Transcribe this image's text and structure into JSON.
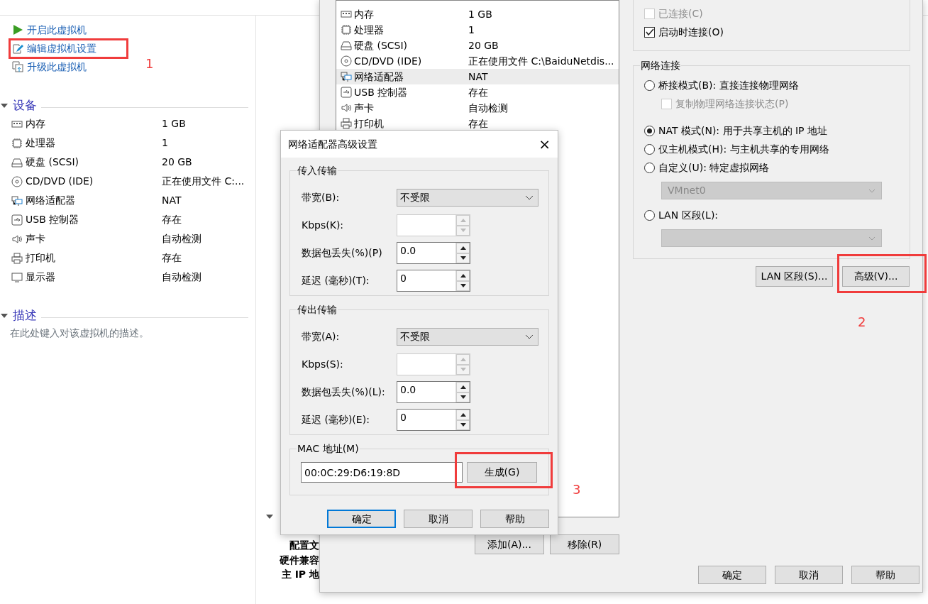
{
  "vm_panel": {
    "actions": [
      {
        "kind": "play",
        "label": "开启此虚拟机"
      },
      {
        "kind": "edit",
        "label": "编辑虚拟机设置"
      },
      {
        "kind": "upgrade",
        "label": "升级此虚拟机"
      }
    ],
    "devices_section": {
      "title": "设备",
      "expanded": true,
      "rows": [
        {
          "kind": "memory",
          "name": "内存",
          "value": "1 GB"
        },
        {
          "kind": "cpu",
          "name": "处理器",
          "value": "1"
        },
        {
          "kind": "disk",
          "name": "硬盘 (SCSI)",
          "value": "20 GB"
        },
        {
          "kind": "cd",
          "name": "CD/DVD (IDE)",
          "value": "正在使用文件 C:..."
        },
        {
          "kind": "network",
          "name": "网络适配器",
          "value": "NAT"
        },
        {
          "kind": "usb",
          "name": "USB 控制器",
          "value": "存在"
        },
        {
          "kind": "sound",
          "name": "声卡",
          "value": "自动检测"
        },
        {
          "kind": "printer",
          "name": "打印机",
          "value": "存在"
        },
        {
          "kind": "display",
          "name": "显示器",
          "value": "自动检测"
        }
      ]
    },
    "description_section": {
      "title": "描述",
      "expanded": true,
      "placeholder": "在此处键入对该虚拟机的描述。"
    },
    "details_section": {
      "expanded": true,
      "labels": [
        "配置文",
        "硬件兼容",
        "主 IP 地"
      ]
    }
  },
  "settings": {
    "devices": [
      {
        "kind": "memory",
        "name": "内存",
        "summary": "1 GB",
        "selected": false
      },
      {
        "kind": "cpu",
        "name": "处理器",
        "summary": "1",
        "selected": false
      },
      {
        "kind": "disk",
        "name": "硬盘 (SCSI)",
        "summary": "20 GB",
        "selected": false
      },
      {
        "kind": "cd",
        "name": "CD/DVD (IDE)",
        "summary": "正在使用文件 C:\\BaiduNetdis...",
        "selected": false
      },
      {
        "kind": "network",
        "name": "网络适配器",
        "summary": "NAT",
        "selected": true
      },
      {
        "kind": "usb",
        "name": "USB 控制器",
        "summary": "存在",
        "selected": false
      },
      {
        "kind": "sound",
        "name": "声卡",
        "summary": "自动检测",
        "selected": false
      },
      {
        "kind": "printer",
        "name": "打印机",
        "summary": "存在",
        "selected": false
      }
    ],
    "list_buttons": [
      "添加(A)...",
      "移除(R)"
    ],
    "device_status": [
      {
        "label": "已连接(C)",
        "checked": false,
        "disabled": true
      },
      {
        "label": "启动时连接(O)",
        "checked": true,
        "disabled": false
      }
    ],
    "network": {
      "title": "网络连接",
      "options": [
        {
          "kind": "radio",
          "label": "桥接模式(B): 直接连接物理网络",
          "selected": false
        },
        {
          "kind": "checkbox",
          "label": "复制物理网络连接状态(P)",
          "checked": false,
          "disabled": true
        },
        {
          "kind": "radio",
          "label": "NAT 模式(N): 用于共享主机的 IP 地址",
          "selected": true
        },
        {
          "kind": "radio",
          "label": "仅主机模式(H): 与主机共享的专用网络",
          "selected": false
        },
        {
          "kind": "radio",
          "label": "自定义(U): 特定虚拟网络",
          "selected": false
        },
        {
          "kind": "select",
          "value": "VMnet0",
          "disabled": true
        },
        {
          "kind": "radio",
          "label": "LAN 区段(L):",
          "selected": false
        },
        {
          "kind": "select",
          "disabled": true
        }
      ]
    },
    "network_buttons": [
      "LAN 区段(S)...",
      "高级(V)..."
    ],
    "footer_buttons": [
      "确定",
      "取消",
      "帮助"
    ]
  },
  "advanced_dialog": {
    "title": "网络适配器高级设置",
    "close": "×",
    "groups": [
      {
        "title": "传入传输",
        "fields": [
          {
            "kind": "select",
            "label": "带宽(B):",
            "value": "不受限"
          },
          {
            "kind": "spin",
            "label": "Kbps(K):",
            "disabled": true
          },
          {
            "kind": "spin",
            "label": "数据包丢失(%)(P)",
            "value": "0.0",
            "disabled": false
          },
          {
            "kind": "spin",
            "label": "延迟 (毫秒)(T):",
            "value": "0",
            "disabled": false
          }
        ]
      },
      {
        "title": "传出传输",
        "fields": [
          {
            "kind": "select",
            "label": "带宽(A):",
            "value": "不受限"
          },
          {
            "kind": "spin",
            "label": "Kbps(S):",
            "disabled": true
          },
          {
            "kind": "spin",
            "label": "数据包丢失(%)(L):",
            "value": "0.0",
            "disabled": false
          },
          {
            "kind": "spin",
            "label": "延迟 (毫秒)(E):",
            "value": "0",
            "disabled": false
          }
        ]
      }
    ],
    "mac": {
      "title": "MAC 地址(M)",
      "value": "00:0C:29:D6:19:8D",
      "button": "生成(G)"
    },
    "buttons": [
      {
        "label": "确定",
        "default": true
      },
      {
        "label": "取消",
        "default": false
      },
      {
        "label": "帮助",
        "default": false
      }
    ]
  },
  "annotations": [
    {
      "label": "1"
    },
    {
      "label": "2"
    },
    {
      "label": "3"
    }
  ]
}
